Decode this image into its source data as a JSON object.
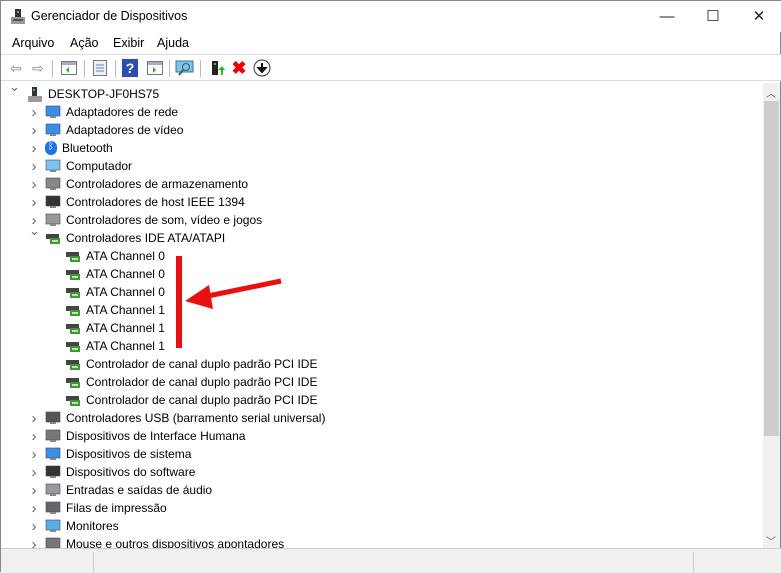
{
  "window": {
    "title": "Gerenciador de Dispositivos",
    "minimize": "—",
    "maximize": "☐",
    "close": "✕"
  },
  "menu": [
    {
      "label": "Arquivo"
    },
    {
      "label": "Ação"
    },
    {
      "label": "Exibir"
    },
    {
      "label": "Ajuda"
    }
  ],
  "toolbar": [
    "back-icon",
    "forward-icon",
    "show-hide-console-tree-icon",
    "properties-icon",
    "help-icon",
    "show-action-pane-icon",
    "scan-hardware-icon",
    "update-driver-icon",
    "uninstall-icon",
    "disable-icon"
  ],
  "tree": {
    "root": "DESKTOP-JF0HS75",
    "categories": [
      {
        "label": "Adaptadores de rede",
        "icon": "network-icon"
      },
      {
        "label": "Adaptadores de vídeo",
        "icon": "display-adapter-icon"
      },
      {
        "label": "Bluetooth",
        "icon": "bluetooth-icon"
      },
      {
        "label": "Computador",
        "icon": "computer-icon"
      },
      {
        "label": "Controladores de armazenamento",
        "icon": "storage-icon"
      },
      {
        "label": "Controladores de host IEEE 1394",
        "icon": "ieee1394-icon"
      },
      {
        "label": "Controladores de som, vídeo e jogos",
        "icon": "speaker-icon"
      },
      {
        "label": "Controladores IDE ATA/ATAPI",
        "icon": "ide-icon",
        "expanded": true,
        "children": [
          "ATA Channel 0",
          "ATA Channel 0",
          "ATA Channel 0",
          "ATA Channel 1",
          "ATA Channel 1",
          "ATA Channel 1",
          "Controlador de canal duplo padrão PCI IDE",
          "Controlador de canal duplo padrão PCI IDE",
          "Controlador de canal duplo padrão PCI IDE"
        ]
      },
      {
        "label": "Controladores USB (barramento serial universal)",
        "icon": "usb-icon"
      },
      {
        "label": "Dispositivos de Interface Humana",
        "icon": "hid-icon"
      },
      {
        "label": "Dispositivos de sistema",
        "icon": "system-icon"
      },
      {
        "label": "Dispositivos do software",
        "icon": "software-icon"
      },
      {
        "label": "Entradas e saídas de áudio",
        "icon": "audio-io-icon"
      },
      {
        "label": "Filas de impressão",
        "icon": "printer-icon"
      },
      {
        "label": "Monitores",
        "icon": "monitor-icon"
      },
      {
        "label": "Mouse e outros dispositivos apontadores",
        "icon": "mouse-icon"
      }
    ]
  },
  "colors": {
    "annotation": "#e81010",
    "accent": "#0078d7"
  }
}
